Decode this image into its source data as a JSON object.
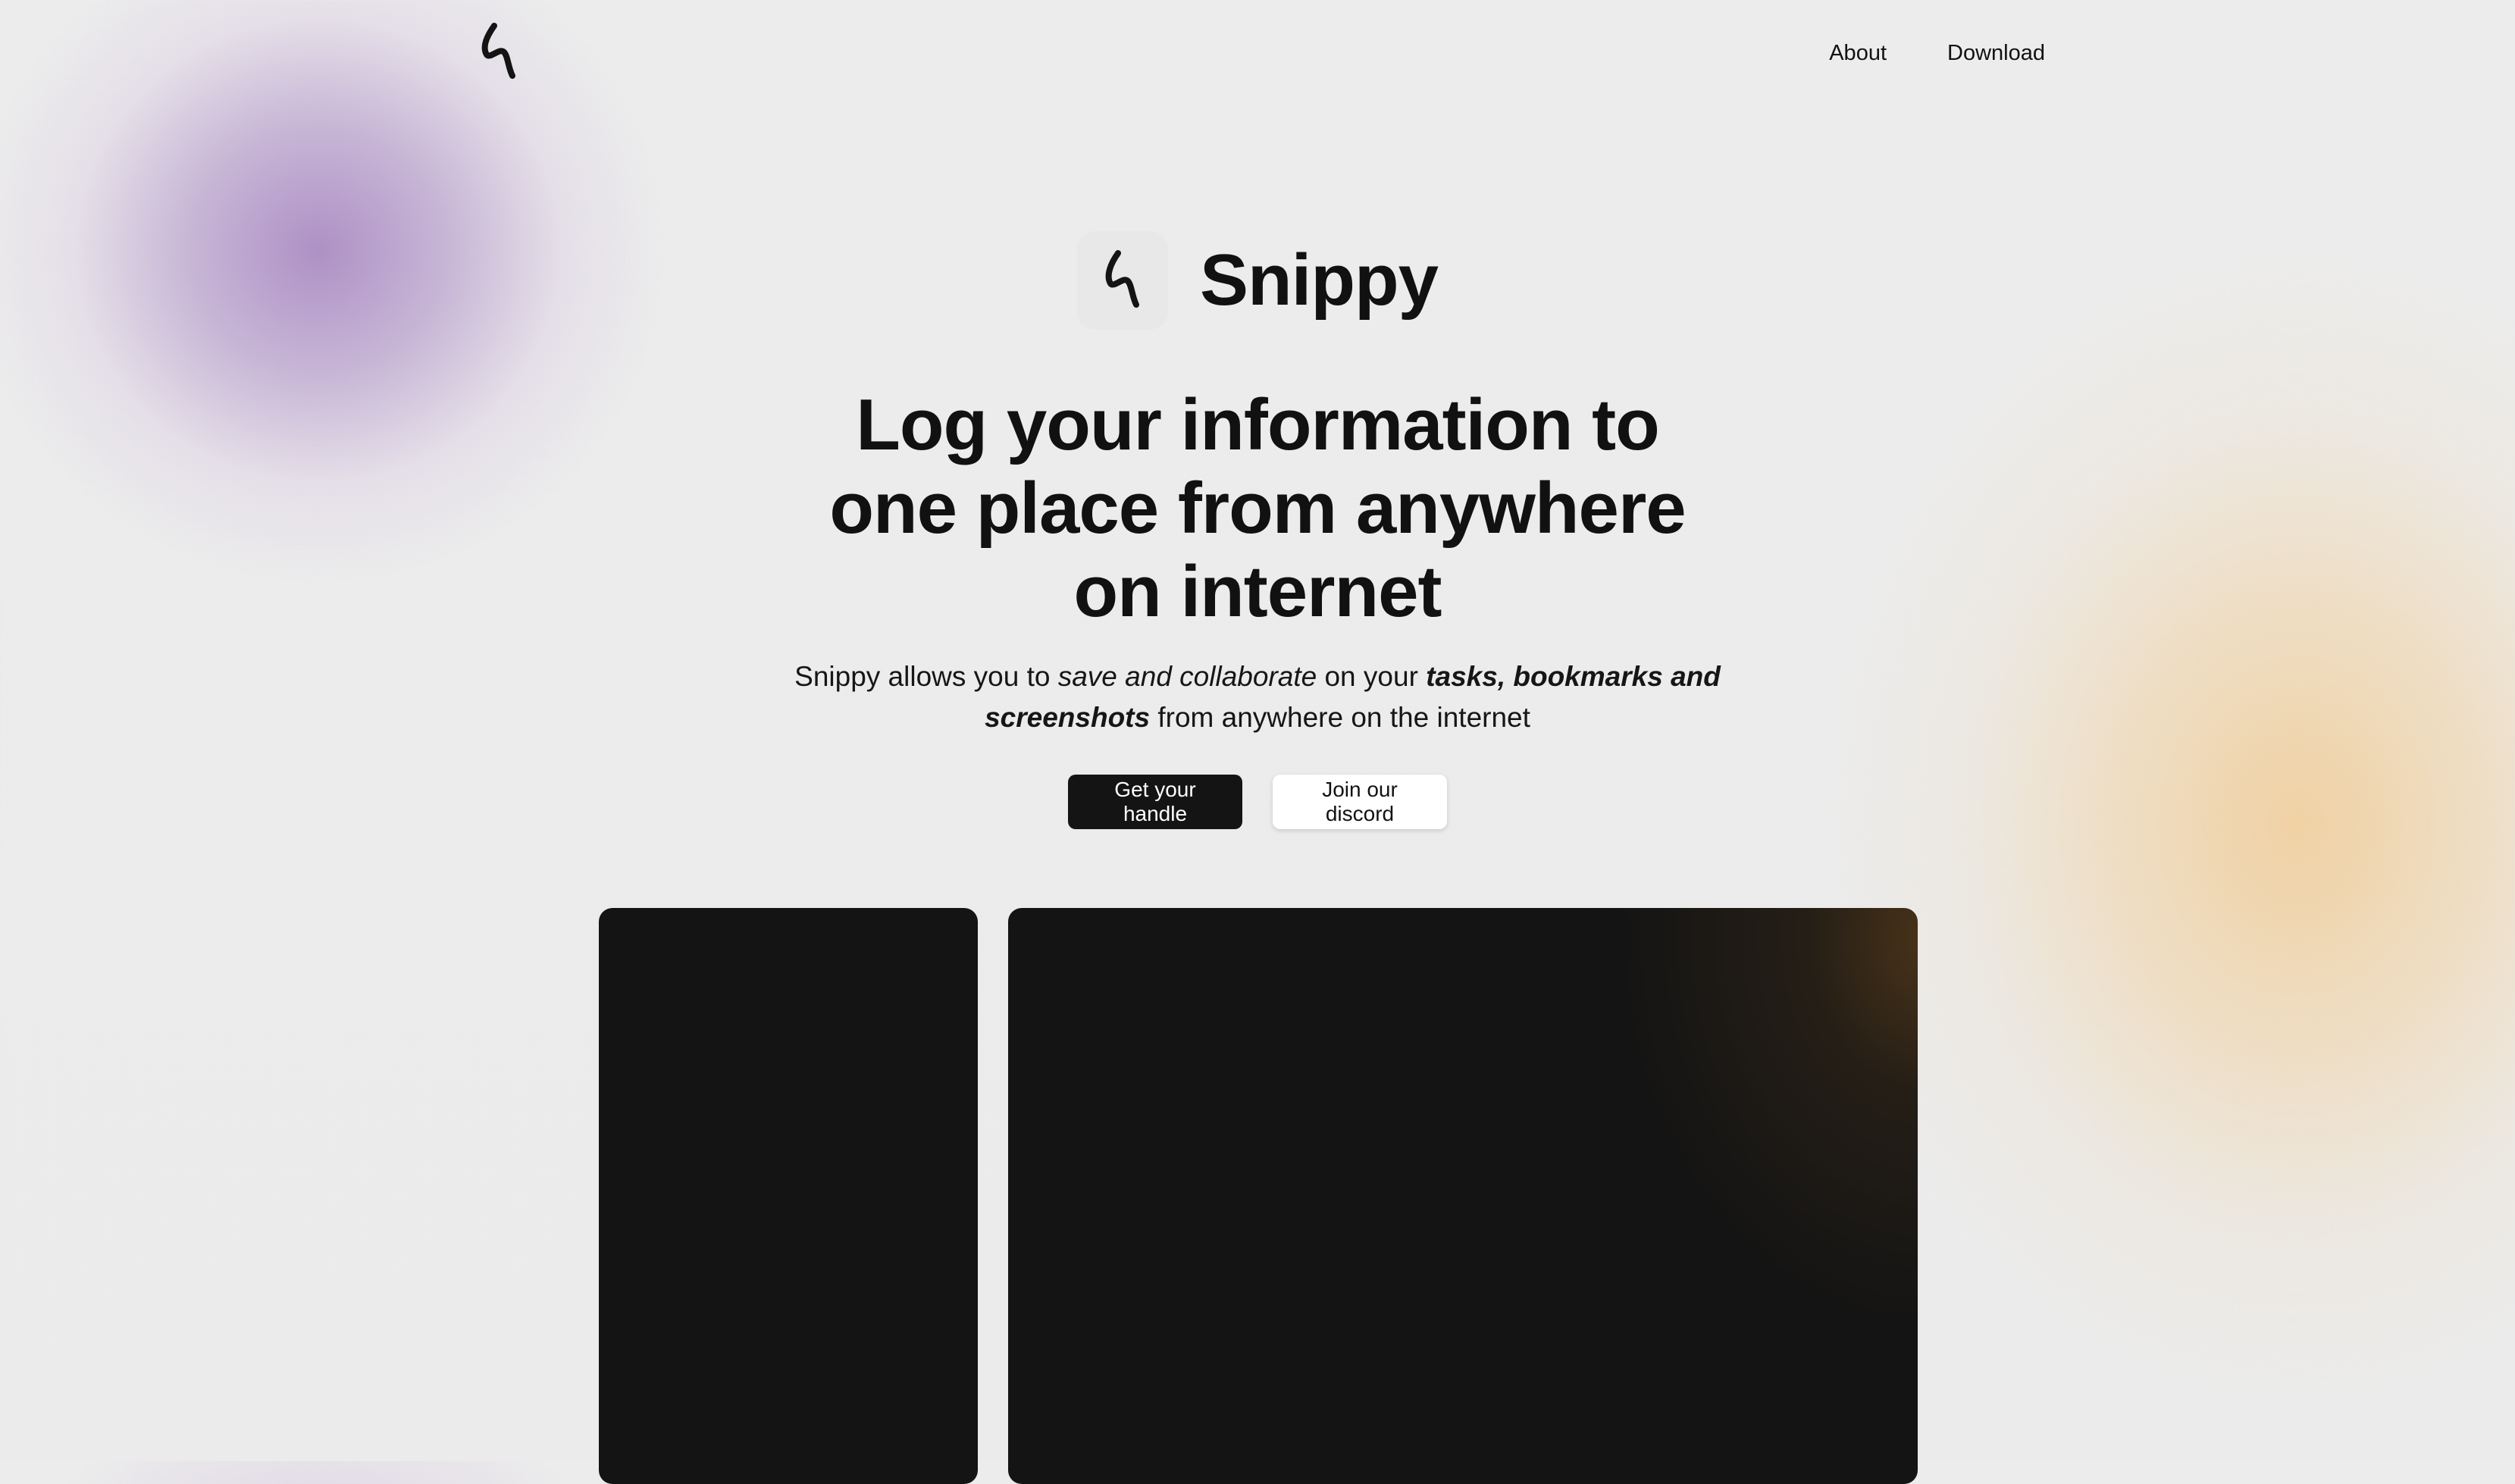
{
  "nav": {
    "logo_icon": "snippy-squiggle-icon",
    "links": [
      {
        "label": "About"
      },
      {
        "label": "Download"
      }
    ]
  },
  "hero": {
    "brand_name": "Snippy",
    "brand_icon": "snippy-squiggle-icon",
    "headline_lines": [
      "Log your information to",
      "one place from anywhere",
      "on internet"
    ],
    "subtitle": {
      "part1": "Snippy allows you to ",
      "part2_italic": "save and collaborate",
      "part3": " on your ",
      "part4_bold_italic": "tasks, bookmarks and screenshots",
      "part5": " from anywhere on the internet"
    }
  },
  "cta": {
    "primary_label": "Get your handle",
    "secondary_label": "Join our discord"
  },
  "colors": {
    "primary_button": "#141414",
    "panel": "#141414",
    "purple_blob": "#b49bc8",
    "orange_blob": "#f0d0a0"
  }
}
